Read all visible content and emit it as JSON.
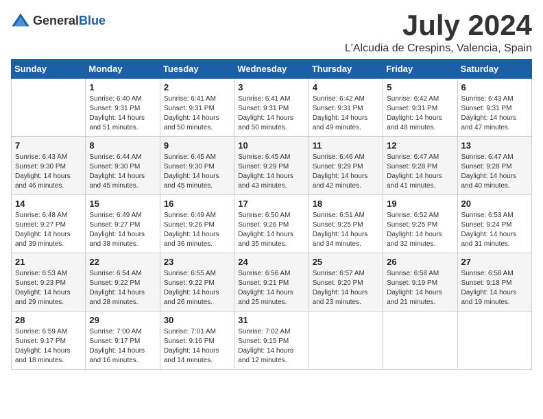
{
  "header": {
    "logo_general": "General",
    "logo_blue": "Blue",
    "month_title": "July 2024",
    "location": "L'Alcudia de Crespins, Valencia, Spain"
  },
  "weekdays": [
    "Sunday",
    "Monday",
    "Tuesday",
    "Wednesday",
    "Thursday",
    "Friday",
    "Saturday"
  ],
  "weeks": [
    [
      {
        "day": "",
        "sunrise": "",
        "sunset": "",
        "daylight": ""
      },
      {
        "day": "1",
        "sunrise": "Sunrise: 6:40 AM",
        "sunset": "Sunset: 9:31 PM",
        "daylight": "Daylight: 14 hours and 51 minutes."
      },
      {
        "day": "2",
        "sunrise": "Sunrise: 6:41 AM",
        "sunset": "Sunset: 9:31 PM",
        "daylight": "Daylight: 14 hours and 50 minutes."
      },
      {
        "day": "3",
        "sunrise": "Sunrise: 6:41 AM",
        "sunset": "Sunset: 9:31 PM",
        "daylight": "Daylight: 14 hours and 50 minutes."
      },
      {
        "day": "4",
        "sunrise": "Sunrise: 6:42 AM",
        "sunset": "Sunset: 9:31 PM",
        "daylight": "Daylight: 14 hours and 49 minutes."
      },
      {
        "day": "5",
        "sunrise": "Sunrise: 6:42 AM",
        "sunset": "Sunset: 9:31 PM",
        "daylight": "Daylight: 14 hours and 48 minutes."
      },
      {
        "day": "6",
        "sunrise": "Sunrise: 6:43 AM",
        "sunset": "Sunset: 9:31 PM",
        "daylight": "Daylight: 14 hours and 47 minutes."
      }
    ],
    [
      {
        "day": "7",
        "sunrise": "Sunrise: 6:43 AM",
        "sunset": "Sunset: 9:30 PM",
        "daylight": "Daylight: 14 hours and 46 minutes."
      },
      {
        "day": "8",
        "sunrise": "Sunrise: 6:44 AM",
        "sunset": "Sunset: 9:30 PM",
        "daylight": "Daylight: 14 hours and 45 minutes."
      },
      {
        "day": "9",
        "sunrise": "Sunrise: 6:45 AM",
        "sunset": "Sunset: 9:30 PM",
        "daylight": "Daylight: 14 hours and 45 minutes."
      },
      {
        "day": "10",
        "sunrise": "Sunrise: 6:45 AM",
        "sunset": "Sunset: 9:29 PM",
        "daylight": "Daylight: 14 hours and 43 minutes."
      },
      {
        "day": "11",
        "sunrise": "Sunrise: 6:46 AM",
        "sunset": "Sunset: 9:29 PM",
        "daylight": "Daylight: 14 hours and 42 minutes."
      },
      {
        "day": "12",
        "sunrise": "Sunrise: 6:47 AM",
        "sunset": "Sunset: 9:28 PM",
        "daylight": "Daylight: 14 hours and 41 minutes."
      },
      {
        "day": "13",
        "sunrise": "Sunrise: 6:47 AM",
        "sunset": "Sunset: 9:28 PM",
        "daylight": "Daylight: 14 hours and 40 minutes."
      }
    ],
    [
      {
        "day": "14",
        "sunrise": "Sunrise: 6:48 AM",
        "sunset": "Sunset: 9:27 PM",
        "daylight": "Daylight: 14 hours and 39 minutes."
      },
      {
        "day": "15",
        "sunrise": "Sunrise: 6:49 AM",
        "sunset": "Sunset: 9:27 PM",
        "daylight": "Daylight: 14 hours and 38 minutes."
      },
      {
        "day": "16",
        "sunrise": "Sunrise: 6:49 AM",
        "sunset": "Sunset: 9:26 PM",
        "daylight": "Daylight: 14 hours and 36 minutes."
      },
      {
        "day": "17",
        "sunrise": "Sunrise: 6:50 AM",
        "sunset": "Sunset: 9:26 PM",
        "daylight": "Daylight: 14 hours and 35 minutes."
      },
      {
        "day": "18",
        "sunrise": "Sunrise: 6:51 AM",
        "sunset": "Sunset: 9:25 PM",
        "daylight": "Daylight: 14 hours and 34 minutes."
      },
      {
        "day": "19",
        "sunrise": "Sunrise: 6:52 AM",
        "sunset": "Sunset: 9:25 PM",
        "daylight": "Daylight: 14 hours and 32 minutes."
      },
      {
        "day": "20",
        "sunrise": "Sunrise: 6:53 AM",
        "sunset": "Sunset: 9:24 PM",
        "daylight": "Daylight: 14 hours and 31 minutes."
      }
    ],
    [
      {
        "day": "21",
        "sunrise": "Sunrise: 6:53 AM",
        "sunset": "Sunset: 9:23 PM",
        "daylight": "Daylight: 14 hours and 29 minutes."
      },
      {
        "day": "22",
        "sunrise": "Sunrise: 6:54 AM",
        "sunset": "Sunset: 9:22 PM",
        "daylight": "Daylight: 14 hours and 28 minutes."
      },
      {
        "day": "23",
        "sunrise": "Sunrise: 6:55 AM",
        "sunset": "Sunset: 9:22 PM",
        "daylight": "Daylight: 14 hours and 26 minutes."
      },
      {
        "day": "24",
        "sunrise": "Sunrise: 6:56 AM",
        "sunset": "Sunset: 9:21 PM",
        "daylight": "Daylight: 14 hours and 25 minutes."
      },
      {
        "day": "25",
        "sunrise": "Sunrise: 6:57 AM",
        "sunset": "Sunset: 9:20 PM",
        "daylight": "Daylight: 14 hours and 23 minutes."
      },
      {
        "day": "26",
        "sunrise": "Sunrise: 6:58 AM",
        "sunset": "Sunset: 9:19 PM",
        "daylight": "Daylight: 14 hours and 21 minutes."
      },
      {
        "day": "27",
        "sunrise": "Sunrise: 6:58 AM",
        "sunset": "Sunset: 9:18 PM",
        "daylight": "Daylight: 14 hours and 19 minutes."
      }
    ],
    [
      {
        "day": "28",
        "sunrise": "Sunrise: 6:59 AM",
        "sunset": "Sunset: 9:17 PM",
        "daylight": "Daylight: 14 hours and 18 minutes."
      },
      {
        "day": "29",
        "sunrise": "Sunrise: 7:00 AM",
        "sunset": "Sunset: 9:17 PM",
        "daylight": "Daylight: 14 hours and 16 minutes."
      },
      {
        "day": "30",
        "sunrise": "Sunrise: 7:01 AM",
        "sunset": "Sunset: 9:16 PM",
        "daylight": "Daylight: 14 hours and 14 minutes."
      },
      {
        "day": "31",
        "sunrise": "Sunrise: 7:02 AM",
        "sunset": "Sunset: 9:15 PM",
        "daylight": "Daylight: 14 hours and 12 minutes."
      },
      {
        "day": "",
        "sunrise": "",
        "sunset": "",
        "daylight": ""
      },
      {
        "day": "",
        "sunrise": "",
        "sunset": "",
        "daylight": ""
      },
      {
        "day": "",
        "sunrise": "",
        "sunset": "",
        "daylight": ""
      }
    ]
  ]
}
